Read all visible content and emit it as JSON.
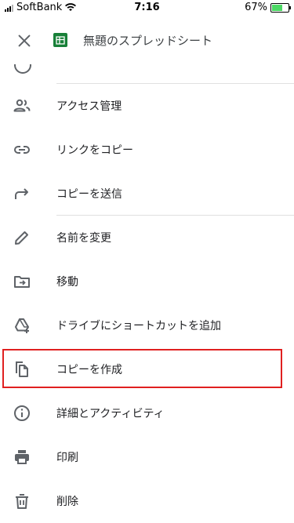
{
  "status_bar": {
    "carrier": "SoftBank",
    "time": "7:16",
    "battery_percent": "67%",
    "battery_level": 0.67
  },
  "header": {
    "title": "無題のスプレッドシート"
  },
  "menu": {
    "partial_label": "",
    "items": [
      {
        "label": "アクセス管理",
        "icon": "people-icon"
      },
      {
        "label": "リンクをコピー",
        "icon": "link-icon"
      },
      {
        "label": "コピーを送信",
        "icon": "forward-icon"
      },
      {
        "label": "名前を変更",
        "icon": "pencil-icon"
      },
      {
        "label": "移動",
        "icon": "move-folder-icon"
      },
      {
        "label": "ドライブにショートカットを追加",
        "icon": "drive-shortcut-icon"
      },
      {
        "label": "コピーを作成",
        "icon": "copy-icon"
      },
      {
        "label": "詳細とアクティビティ",
        "icon": "info-icon"
      },
      {
        "label": "印刷",
        "icon": "print-icon"
      },
      {
        "label": "削除",
        "icon": "trash-icon"
      }
    ]
  },
  "colors": {
    "highlight": "#e02020",
    "sheets_green": "#188038",
    "icon_gray": "#5f6368"
  }
}
